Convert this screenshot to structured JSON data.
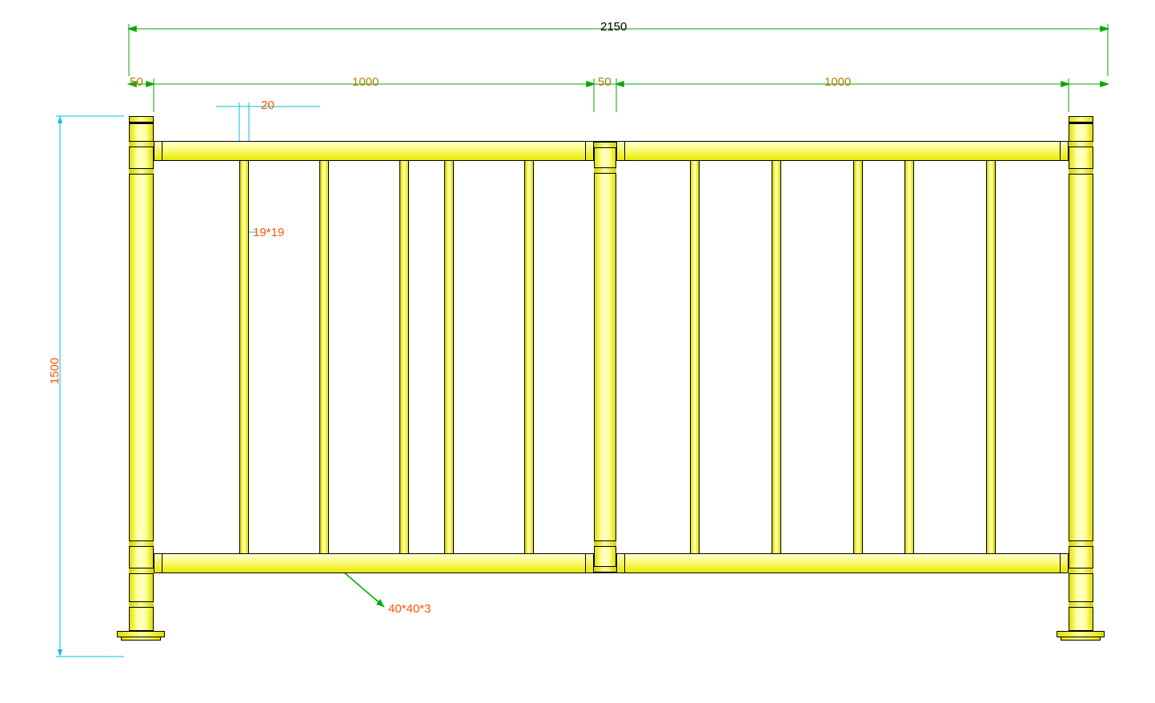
{
  "dimensions": {
    "overall_width": "2150",
    "post_width_left": "50",
    "span_1": "1000",
    "mid_post_width": "50",
    "span_2": "1000",
    "picket_size_label": "20",
    "picket_detail": "19*19",
    "overall_height": "1500",
    "rail_size": "40*40*3"
  },
  "diagram": {
    "type": "fence_railing_elevation",
    "description": "Technical CAD elevation drawing of a yellow metal fence/railing with two 1000mm panels, 50mm posts, 19x19 pickets, and 40x40x3 horizontal rails."
  }
}
